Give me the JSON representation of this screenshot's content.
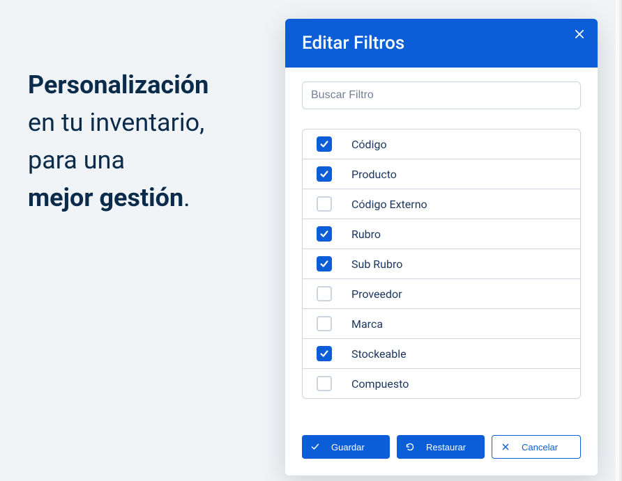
{
  "hero": {
    "line1_bold": "Personalización",
    "line2": "en tu inventario,",
    "line3": "para una",
    "line4_bold": "mejor gestión",
    "period": "."
  },
  "modal": {
    "title": "Editar Filtros",
    "search_placeholder": "Buscar Filtro",
    "filters": [
      {
        "label": "Código",
        "checked": true
      },
      {
        "label": "Producto",
        "checked": true
      },
      {
        "label": "Código Externo",
        "checked": false
      },
      {
        "label": "Rubro",
        "checked": true
      },
      {
        "label": "Sub Rubro",
        "checked": true
      },
      {
        "label": "Proveedor",
        "checked": false
      },
      {
        "label": "Marca",
        "checked": false
      },
      {
        "label": "Stockeable",
        "checked": true
      },
      {
        "label": "Compuesto",
        "checked": false
      }
    ],
    "buttons": {
      "save": "Guardar",
      "restore": "Restaurar",
      "cancel": "Cancelar"
    }
  },
  "colors": {
    "primary": "#0b5ed7",
    "text_dark": "#1a365d"
  }
}
